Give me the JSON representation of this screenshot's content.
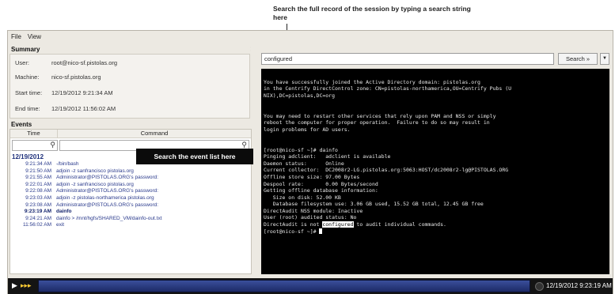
{
  "annotations": {
    "search_record": "Search the full record of the session by typing a search string here",
    "search_events": "Search the event list here"
  },
  "menu": {
    "file": "File",
    "view": "View"
  },
  "collapse_glyph": "<<",
  "summary": {
    "title": "Summary",
    "rows": [
      {
        "label": "User:",
        "value": "root@nico-sf.pistolas.org"
      },
      {
        "label": "Machine:",
        "value": "nico-sf.pistolas.org"
      },
      {
        "label": "Start time:",
        "value": "12/19/2012 9:21:34 AM"
      },
      {
        "label": "End time:",
        "value": "12/19/2012 11:56:02 AM"
      }
    ]
  },
  "events": {
    "title": "Events",
    "col_time": "Time",
    "col_command": "Command",
    "date": "12/19/2012",
    "rows": [
      {
        "time": "9:21:34 AM",
        "command": "-/bin/bash",
        "bold": false
      },
      {
        "time": "9:21:50 AM",
        "command": "adjoin -z sanfrancisco pistolas.org",
        "bold": false
      },
      {
        "time": "9:21:55 AM",
        "command": "Administrator@PISTOLAS.ORG's password:",
        "bold": false
      },
      {
        "time": "9:22:01 AM",
        "command": "adjoin -z sanfrancisco pistolas.org",
        "bold": false
      },
      {
        "time": "9:22:08 AM",
        "command": "Administrator@PISTOLAS.ORG's password:",
        "bold": false
      },
      {
        "time": "9:23:03 AM",
        "command": "adjoin -z pistolas-northamerica pistolas.org",
        "bold": false
      },
      {
        "time": "9:23:08 AM",
        "command": "Administrator@PISTOLAS.ORG's password:",
        "bold": false
      },
      {
        "time": "9:23:19 AM",
        "command": "dainfo",
        "bold": true
      },
      {
        "time": "9:24:21 AM",
        "command": "dainfo > /mnt/hgfs/SHARED_VM/dainfo-out.txt",
        "bold": false
      },
      {
        "time": "11:56:02 AM",
        "command": "exit",
        "bold": false
      }
    ]
  },
  "search": {
    "value": "configured",
    "button_label": "Search »",
    "dropdown_glyph": "▼"
  },
  "terminal": {
    "lines": [
      "",
      "You have successfully joined the Active Directory domain: pistolas.org",
      "in the Centrify DirectControl zone: CN=pistolas-northamerica,OU=Centrify Pubs (U",
      "NIX),DC=pistolas,DC=org",
      "",
      "",
      "You may need to restart other services that rely upon PAM and NSS or simply",
      "reboot the computer for proper operation.  Failure to do so may result in",
      "login problems for AD users.",
      "",
      "",
      "[root@nico-sf ~]# dainfo",
      "Pinging adclient:   adclient is available",
      "Daemon status:      Online",
      "Current collector:  DC2008r2-LG.pistolas.org:5063:HOST/dc2008r2-lg@PISTOLAS.ORG",
      "Offline store size: 97.00 Bytes",
      "Despool rate:       0.00 Bytes/second",
      "Getting offline database information:",
      "   Size on disk: 52.00 KB",
      "   Database filesystem use: 3.06 GB used, 15.52 GB total, 12.45 GB free",
      "DirectAudit NSS module: Inactive",
      "User (root) audited status: No"
    ],
    "last_line_before": "DirectAudit is not ",
    "last_line_highlight": "configured",
    "last_line_after": " to audit individual commands.",
    "prompt": "[root@nico-sf ~]# "
  },
  "player": {
    "play_glyph": "▶",
    "ffwd_glyph": "▸▸▸",
    "time": "12/19/2012 9:23:19 AM"
  }
}
